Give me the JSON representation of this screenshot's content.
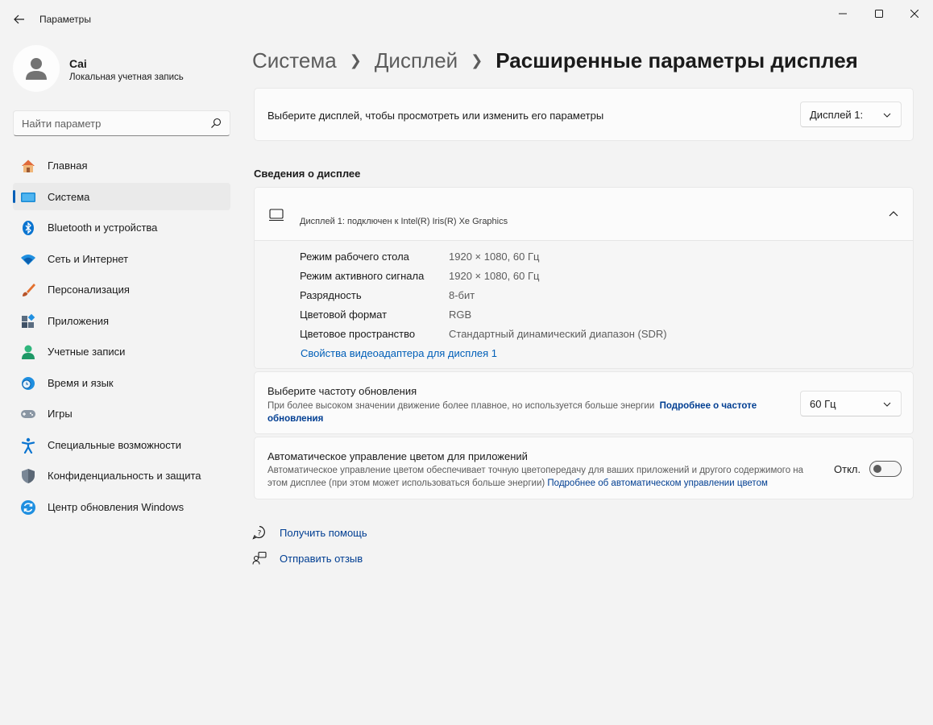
{
  "window": {
    "title": "Параметры"
  },
  "profile": {
    "name": "Cai",
    "account_type": "Локальная учетная запись"
  },
  "search": {
    "placeholder": "Найти параметр"
  },
  "sidebar": {
    "items": [
      {
        "label": "Главная",
        "icon": "home-icon",
        "active": false
      },
      {
        "label": "Система",
        "icon": "system-icon",
        "active": true
      },
      {
        "label": "Bluetooth и устройства",
        "icon": "bluetooth-icon",
        "active": false
      },
      {
        "label": "Сеть и Интернет",
        "icon": "wifi-icon",
        "active": false
      },
      {
        "label": "Персонализация",
        "icon": "brush-icon",
        "active": false
      },
      {
        "label": "Приложения",
        "icon": "apps-icon",
        "active": false
      },
      {
        "label": "Учетные записи",
        "icon": "accounts-icon",
        "active": false
      },
      {
        "label": "Время и язык",
        "icon": "time-language-icon",
        "active": false
      },
      {
        "label": "Игры",
        "icon": "gamepad-icon",
        "active": false
      },
      {
        "label": "Специальные возможности",
        "icon": "accessibility-icon",
        "active": false
      },
      {
        "label": "Конфиденциальность и защита",
        "icon": "shield-icon",
        "active": false
      },
      {
        "label": "Центр обновления Windows",
        "icon": "update-icon",
        "active": false
      }
    ]
  },
  "breadcrumb": {
    "items": [
      "Система",
      "Дисплей"
    ],
    "current": "Расширенные параметры дисплея"
  },
  "display_select": {
    "label": "Выберите дисплей, чтобы просмотреть или изменить его параметры",
    "value": "Дисплей 1:"
  },
  "info": {
    "section_title": "Сведения о дисплее",
    "header": "Дисплей 1: подключен к Intel(R) Iris(R) Xe Graphics",
    "rows": [
      {
        "key": "Режим рабочего стола",
        "value": "1920 × 1080, 60 Гц"
      },
      {
        "key": "Режим активного сигнала",
        "value": "1920 × 1080, 60 Гц"
      },
      {
        "key": "Разрядность",
        "value": "8-бит"
      },
      {
        "key": "Цветовой формат",
        "value": "RGB"
      },
      {
        "key": "Цветовое пространство",
        "value": "Стандартный динамический диапазон (SDR)"
      }
    ],
    "adapter_link": "Свойства видеоадаптера для дисплея 1"
  },
  "refresh": {
    "title": "Выберите частоту обновления",
    "description": "При более высоком значении движение более плавное, но используется больше энергии",
    "link": "Подробнее о частоте обновления",
    "value": "60 Гц"
  },
  "color_management": {
    "title": "Автоматическое управление цветом для приложений",
    "description": "Автоматическое управление цветом обеспечивает точную цветопередачу для ваших приложений и другого содержимого на этом дисплее (при этом может использоваться больше энергии)",
    "link": "Подробнее об автоматическом управлении цветом",
    "toggle_label": "Откл.",
    "toggle_on": false
  },
  "help": {
    "get_help": "Получить помощь",
    "feedback": "Отправить отзыв"
  },
  "colors": {
    "accent": "#005fb8",
    "link": "#003e92",
    "background": "#f3f3f3",
    "card": "#fbfbfb"
  }
}
